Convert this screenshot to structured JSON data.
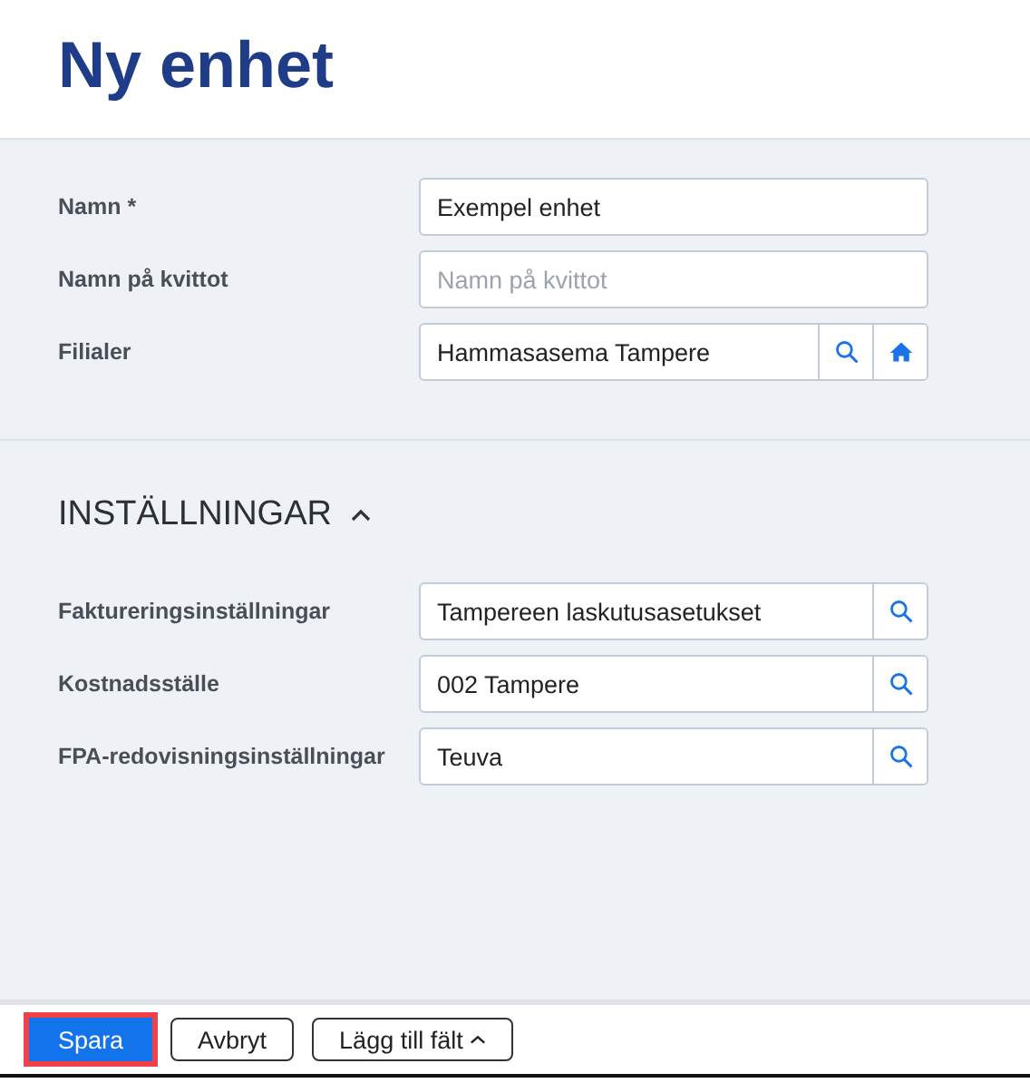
{
  "title": "Ny enhet",
  "fields": [
    {
      "label": "Namn *",
      "value": "Exempel enhet"
    },
    {
      "label": "Namn på kvittot",
      "placeholder": "Namn på kvittot"
    },
    {
      "label": "Filialer",
      "value": "Hammasasema Tampere",
      "search_button": true,
      "home_button": true
    }
  ],
  "settings": {
    "title": "INSTÄLLNINGAR",
    "expanded": true,
    "fields": [
      {
        "label": "Faktureringsinställningar",
        "value": "Tampereen laskutusasetukset",
        "search_button": true
      },
      {
        "label": "Kostnadsställe",
        "value": "002 Tampere",
        "search_button": true
      },
      {
        "label": "FPA-redovisningsinställningar",
        "value": "Teuva",
        "search_button": true
      }
    ]
  },
  "footer_buttons": [
    {
      "label": "Spara",
      "kind": "primary",
      "focused": true
    },
    {
      "label": "Avbryt",
      "kind": "outline",
      "focused": false
    },
    {
      "label": "Lägg till fält",
      "kind": "dropdown",
      "focused": false
    }
  ]
}
